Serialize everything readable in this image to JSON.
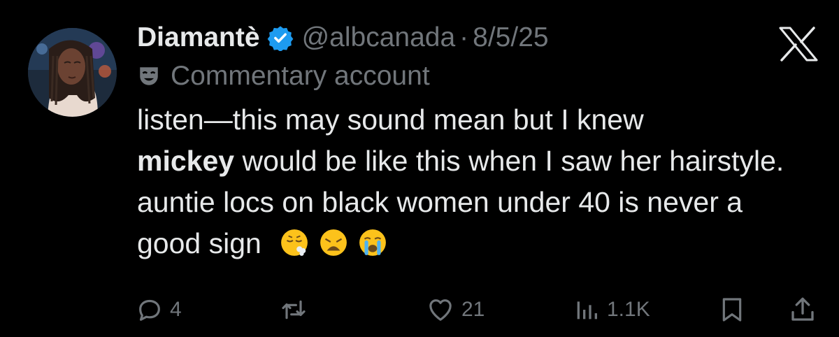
{
  "header": {
    "display_name": "Diamantè",
    "handle": "@albcanada",
    "separator": "·",
    "date": "8/5/25"
  },
  "account_label": "Commentary account",
  "tweet": {
    "segment1": "listen—this may sound mean but I knew",
    "mention": "mickey",
    "segment2": " would be like this when I saw her hairstyle. auntie locs on black women under 40 is never a good sign",
    "emojis": [
      "face-exhaling-emoji",
      "weary-face-emoji",
      "loudly-crying-face-emoji"
    ]
  },
  "actions": {
    "replies": "4",
    "likes": "21",
    "views": "1.1K"
  },
  "colors": {
    "background": "#000000",
    "text": "#e7e9ea",
    "muted": "#71767b",
    "verified": "#1d9bf0"
  }
}
